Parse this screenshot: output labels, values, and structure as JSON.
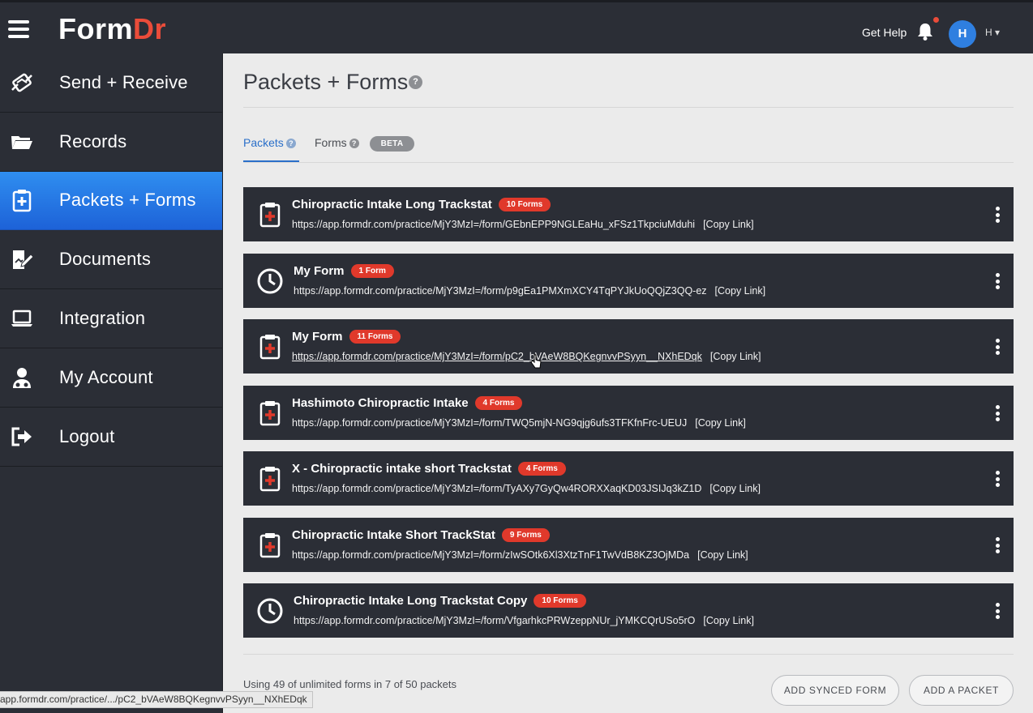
{
  "header": {
    "logo_form": "Form",
    "logo_dr": "Dr",
    "get_help": "Get Help",
    "avatar_letter": "H",
    "user_label": "H ▾"
  },
  "sidebar": {
    "items": [
      {
        "label": "Send + Receive",
        "icon": "send-receive-icon"
      },
      {
        "label": "Records",
        "icon": "folder-icon"
      },
      {
        "label": "Packets + Forms",
        "icon": "clipboard-plus-icon",
        "active": true
      },
      {
        "label": "Documents",
        "icon": "document-pen-icon"
      },
      {
        "label": "Integration",
        "icon": "laptop-icon"
      },
      {
        "label": "My Account",
        "icon": "doctor-icon"
      },
      {
        "label": "Logout",
        "icon": "logout-icon"
      }
    ]
  },
  "main": {
    "title": "Packets + Forms",
    "help_q": "?",
    "tabs": {
      "packets": "Packets",
      "forms": "Forms",
      "beta": "BETA"
    },
    "packets": [
      {
        "name": "Chiropractic Intake Long Trackstat",
        "badge": "10 Forms",
        "icon": "clipboard-icon",
        "url": "https://app.formdr.com/practice/MjY3MzI=/form/GEbnEPP9NGLEaHu_xFSz1TkpciuMduhi",
        "copy": "[Copy Link]"
      },
      {
        "name": "My Form",
        "badge": "1 Form",
        "icon": "clock-icon",
        "url": "https://app.formdr.com/practice/MjY3MzI=/form/p9gEa1PMXmXCY4TqPYJkUoQQjZ3QQ-ez",
        "copy": "[Copy Link]"
      },
      {
        "name": "My Form",
        "badge": "11 Forms",
        "icon": "clipboard-icon",
        "url": "https://app.formdr.com/practice/MjY3MzI=/form/pC2_bVAeW8BQKegnvvPSyyn__NXhEDqk",
        "copy": "[Copy Link]"
      },
      {
        "name": "Hashimoto Chiropractic Intake",
        "badge": "4 Forms",
        "icon": "clipboard-icon",
        "url": "https://app.formdr.com/practice/MjY3MzI=/form/TWQ5mjN-NG9qjg6ufs3TFKfnFrc-UEUJ",
        "copy": "[Copy Link]"
      },
      {
        "name": "X - Chiropractic intake short Trackstat",
        "badge": "4 Forms",
        "icon": "clipboard-icon",
        "url": "https://app.formdr.com/practice/MjY3MzI=/form/TyAXy7GyQw4RORXXaqKD03JSIJq3kZ1D",
        "copy": "[Copy Link]"
      },
      {
        "name": "Chiropractic Intake Short TrackStat",
        "badge": "9 Forms",
        "icon": "clipboard-icon",
        "url": "https://app.formdr.com/practice/MjY3MzI=/form/zIwSOtk6Xl3XtzTnF1TwVdB8KZ3OjMDa",
        "copy": "[Copy Link]"
      },
      {
        "name": "Chiropractic Intake Long Trackstat Copy",
        "badge": "10 Forms",
        "icon": "clock-icon",
        "url": "https://app.formdr.com/practice/MjY3MzI=/form/VfgarhkcPRWzeppNUr_jYMKCQrUSo5rO",
        "copy": "[Copy Link]"
      }
    ],
    "usage": "Using 49 of unlimited forms in 7 of 50 packets",
    "buttons": {
      "add_synced_form": "ADD SYNCED FORM",
      "add_packet": "ADD A PACKET"
    }
  },
  "statusbar": {
    "text": "app.formdr.com/practice/.../pC2_bVAeW8BQKegnvvPSyyn__NXhEDqk"
  },
  "colors": {
    "dark": "#2b2e36",
    "accent_blue": "#2a6fc9",
    "badge_red": "#e0392b",
    "logo_red": "#ea4c3a"
  }
}
